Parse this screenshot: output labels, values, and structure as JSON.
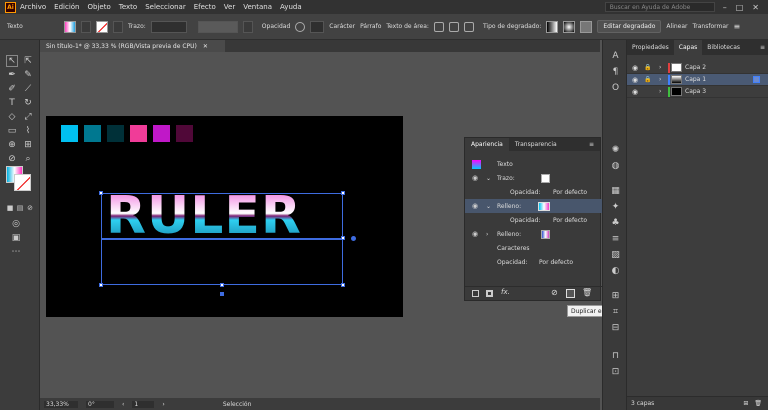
{
  "app": {
    "logo": "Ai"
  },
  "menu": [
    "Archivo",
    "Edición",
    "Objeto",
    "Texto",
    "Seleccionar",
    "Efecto",
    "Ver",
    "Ventana",
    "Ayuda"
  ],
  "search": {
    "placeholder": "Buscar en Ayuda de Adobe"
  },
  "control_bar": {
    "selection_type": "Texto",
    "stroke_label": "Trazo:",
    "opacity_label": "Opacidad",
    "character_label": "Carácter",
    "paragraph_label": "Párrafo",
    "area_text_label": "Texto de área:",
    "gradient_type_label": "Tipo de degradado:",
    "edit_gradient_button": "Editar degradado",
    "align_label": "Alinear",
    "transform_label": "Transformar"
  },
  "document_tab": {
    "title": "Sin título-1* @ 33,33 % (RGB/Vista previa de CPU)"
  },
  "artboard": {
    "text": "RULER",
    "swatches": [
      "#00c0f0",
      "#007890",
      "#003038",
      "#f03c98",
      "#c018c8",
      "#500838"
    ]
  },
  "appearance_panel": {
    "tabs": [
      "Apariencia",
      "Transparencia"
    ],
    "rows": [
      {
        "label": "Texto",
        "value": ""
      },
      {
        "label": "Trazo:",
        "value": ""
      },
      {
        "label": "Opacidad:",
        "value": "Por defecto"
      },
      {
        "label": "Relleno:",
        "value": ""
      },
      {
        "label": "Opacidad:",
        "value": "Por defecto"
      },
      {
        "label": "Relleno:",
        "value": ""
      },
      {
        "label": "Caracteres",
        "value": ""
      },
      {
        "label": "Opacidad:",
        "value": "Por defecto"
      }
    ],
    "tooltip": "Duplicar elemento seleccionado"
  },
  "layers_panel": {
    "tabs": [
      "Propiedades",
      "Capas",
      "Bibliotecas"
    ],
    "layers": [
      {
        "name": "Capa 2",
        "color": "#e04040"
      },
      {
        "name": "Capa 1",
        "color": "#4080ff"
      },
      {
        "name": "Capa 3",
        "color": "#40c040"
      }
    ],
    "footer": "3 capas"
  },
  "status_bar": {
    "zoom": "33,33%",
    "rotation": "0°",
    "artboard_num": "1",
    "tool": "Selección"
  }
}
